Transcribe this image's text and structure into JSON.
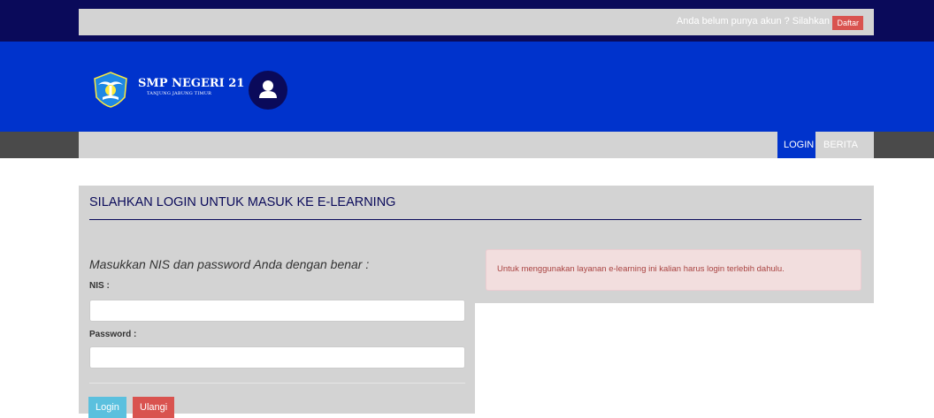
{
  "topbar": {
    "signup_prompt": "Anda belum punya akun ? Silahkan",
    "signup_button": "Daftar"
  },
  "header": {
    "school_name": "SMP NEGERI 21",
    "school_location": "TANJUNG JABUNG TIMUR",
    "icons": {
      "logo": "tut-wuri-handayani-logo",
      "user": "user-icon"
    }
  },
  "nav": {
    "items": [
      {
        "label": "LOGIN",
        "active": true
      },
      {
        "label": "BERITA",
        "active": false
      }
    ]
  },
  "login": {
    "title": "SILAHKAN LOGIN UNTUK MASUK KE E-LEARNING",
    "instruction": "Masukkan NIS dan password Anda dengan benar :",
    "nis_label": "NIS :",
    "nis_value": "",
    "password_label": "Password :",
    "password_value": "",
    "login_button": "Login",
    "reset_button": "Ulangi"
  },
  "alert": {
    "message": "Untuk menggunakan layanan e-learning ini kalian harus login terlebih dahulu."
  },
  "colors": {
    "navy": "#0a0a5a",
    "header_blue": "#0033cc",
    "panel_gray": "#d3d3d3",
    "danger": "#d9534f",
    "info": "#5bc0de"
  }
}
